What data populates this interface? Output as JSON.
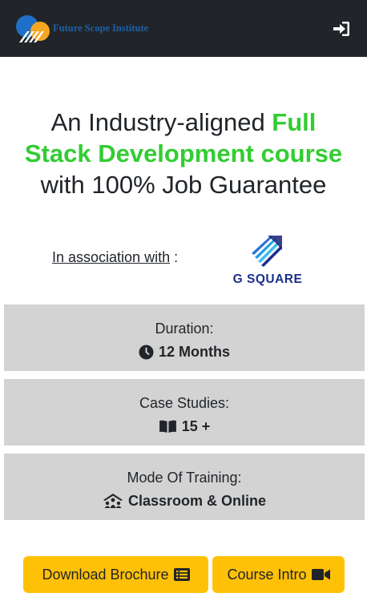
{
  "header": {
    "brand_name": "Future Scope Institute",
    "logo_icon": "cloud-logo-icon",
    "login_icon": "sign-in-icon"
  },
  "hero": {
    "line1_prefix": "An Industry-aligned ",
    "line1_highlight": "Full",
    "line2_highlight": "Stack Development course",
    "line3": "with 100% Job Guarantee",
    "highlight_color": "#32cd32"
  },
  "association": {
    "label": "In association with",
    "separator": " :",
    "partner_name": "G SQUARE"
  },
  "info_cards": [
    {
      "label": "Duration:",
      "value": "12 Months",
      "icon": "clock-icon"
    },
    {
      "label": "Case Studies:",
      "value": "15 +",
      "icon": "book-open-icon"
    },
    {
      "label": "Mode Of Training:",
      "value": "Classroom & Online",
      "icon": "chalkboard-teacher-icon"
    }
  ],
  "buttons": {
    "brochure_label": "Download Brochure",
    "brochure_icon": "list-alt-icon",
    "intro_label": "Course Intro",
    "intro_icon": "video-icon",
    "color": "#ffc107"
  },
  "colors": {
    "navbar": "#212529",
    "card_bg": "#d3d3d3",
    "brand": "#1e5fa8",
    "partner": "#1a2e8c"
  }
}
